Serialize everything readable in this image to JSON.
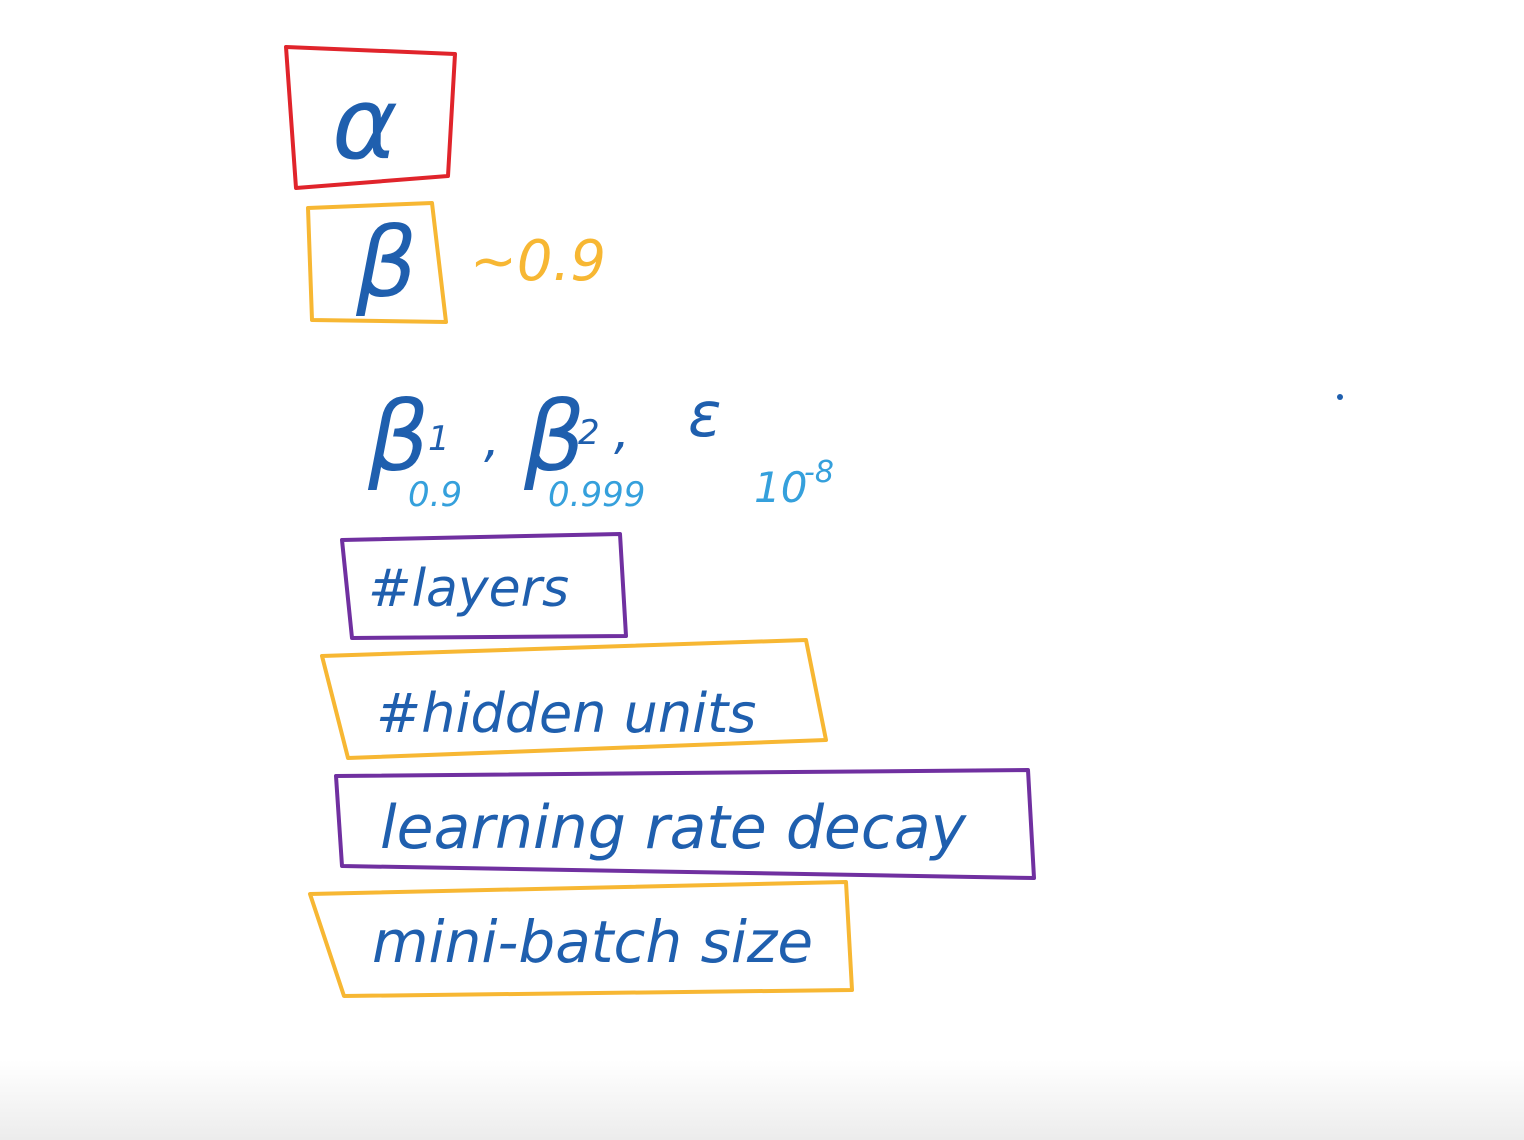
{
  "colors": {
    "blue_ink": "#1f5fae",
    "light_blue_ink": "#35a0dc",
    "red_box": "#e0242b",
    "orange_box": "#f7b733",
    "purple_box": "#7030a0",
    "background": "#ffffff"
  },
  "items": {
    "alpha": "α",
    "beta": "β",
    "beta_value": "~0.9",
    "beta1": "β",
    "beta1_sub": "1",
    "beta1_value": "0.9",
    "beta2": "β",
    "beta2_sub": "2",
    "beta2_value": "0.999",
    "epsilon": "ε",
    "epsilon_value_base": "10",
    "epsilon_value_exp": "-8",
    "layers": "#layers",
    "hidden_units": "#hidden units",
    "lr_decay": "learning rate decay",
    "mini_batch": "mini-batch size"
  }
}
